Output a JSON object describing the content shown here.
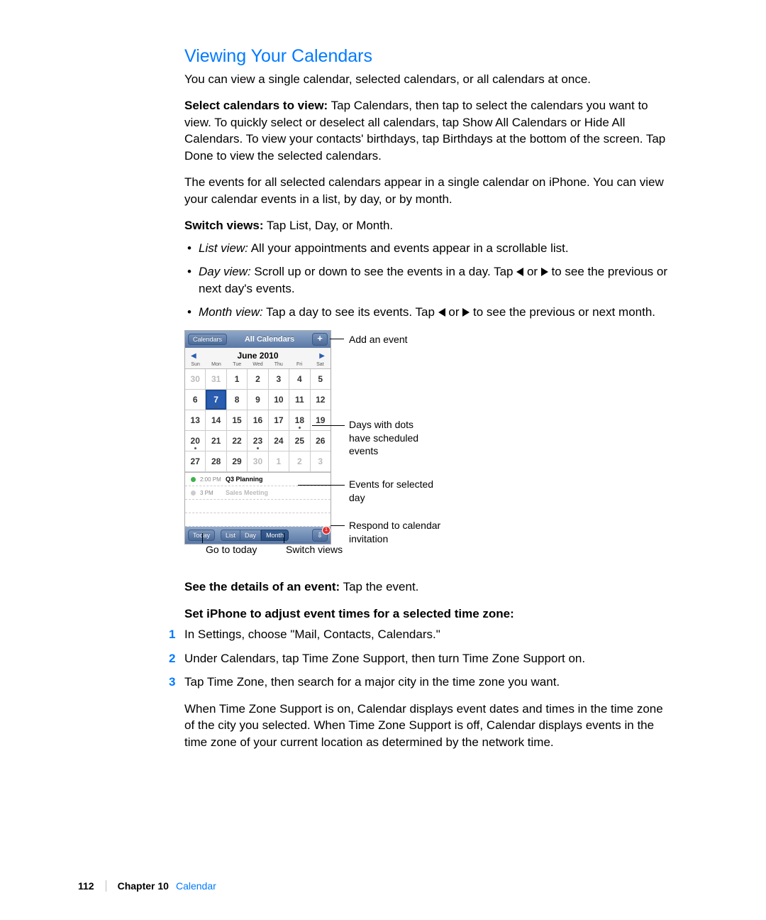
{
  "heading": "Viewing Your Calendars",
  "p1": "You can view a single calendar, selected calendars, or all calendars at once.",
  "p2_lead": "Select calendars to view:",
  "p2_rest": "  Tap Calendars, then tap to select the calendars you want to view. To quickly select or deselect all calendars, tap Show All Calendars or Hide All Calendars. To view your contacts' birthdays, tap Birthdays at the bottom of the screen. Tap Done to view the selected calendars.",
  "p3": "The events for all selected calendars appear in a single calendar on iPhone. You can view your calendar events in a list, by day, or by month.",
  "p4_lead": "Switch views:",
  "p4_rest": "  Tap List, Day, or Month.",
  "bullets": {
    "b1_label": "List view:",
    "b1_rest": " All your appointments and events appear in a scrollable list.",
    "b2_label": "Day view:",
    "b2_a": " Scroll up or down to see the events in a day. Tap ",
    "b2_b": " or ",
    "b2_c": " to see the previous or next day's events.",
    "b3_label": "Month view:",
    "b3_a": " Tap a day to see its events. Tap ",
    "b3_b": " or ",
    "b3_c": " to see the previous or next month."
  },
  "figure": {
    "nav": {
      "calendars_btn": "Calendars",
      "title": "All Calendars"
    },
    "month_title": "June 2010",
    "dow": [
      "Sun",
      "Mon",
      "Tue",
      "Wed",
      "Thu",
      "Fri",
      "Sat"
    ],
    "grid": [
      [
        {
          "n": "30",
          "g": 1
        },
        {
          "n": "31",
          "g": 1
        },
        {
          "n": "1"
        },
        {
          "n": "2"
        },
        {
          "n": "3"
        },
        {
          "n": "4"
        },
        {
          "n": "5"
        }
      ],
      [
        {
          "n": "6"
        },
        {
          "n": "7",
          "sel": 1,
          "d": 1
        },
        {
          "n": "8"
        },
        {
          "n": "9"
        },
        {
          "n": "10"
        },
        {
          "n": "11"
        },
        {
          "n": "12"
        }
      ],
      [
        {
          "n": "13"
        },
        {
          "n": "14"
        },
        {
          "n": "15"
        },
        {
          "n": "16"
        },
        {
          "n": "17"
        },
        {
          "n": "18",
          "d": 1
        },
        {
          "n": "19"
        }
      ],
      [
        {
          "n": "20",
          "d": 1
        },
        {
          "n": "21"
        },
        {
          "n": "22"
        },
        {
          "n": "23",
          "d": 1
        },
        {
          "n": "24"
        },
        {
          "n": "25"
        },
        {
          "n": "26"
        }
      ],
      [
        {
          "n": "27"
        },
        {
          "n": "28"
        },
        {
          "n": "29"
        },
        {
          "n": "30",
          "g": 1
        },
        {
          "n": "1",
          "g": 1
        },
        {
          "n": "2",
          "g": 1
        },
        {
          "n": "3",
          "g": 1
        }
      ]
    ],
    "events": [
      {
        "color": "green",
        "time": "2:00 PM",
        "title": "Q3 Planning"
      },
      {
        "color": "grey",
        "time": "3 PM",
        "title": "Sales Meeting"
      }
    ],
    "toolbar": {
      "today": "Today",
      "list": "List",
      "day": "Day",
      "month": "Month"
    },
    "callouts": {
      "add": "Add an event",
      "dots": "Days with dots have scheduled events",
      "events": "Events for selected day",
      "inbox": "Respond to calendar invitation",
      "today": "Go to today",
      "switch": "Switch views"
    }
  },
  "p5_lead": "See the details of an event:",
  "p5_rest": "  Tap the event.",
  "p6_lead": "Set iPhone to adjust event times for a selected time zone:",
  "steps": {
    "s1": "In Settings, choose \"Mail, Contacts, Calendars.\"",
    "s2": "Under Calendars, tap Time Zone Support, then turn Time Zone Support on.",
    "s3": "Tap Time Zone, then search for a major city in the time zone you want."
  },
  "p7": "When Time Zone Support is on, Calendar displays event dates and times in the time zone of the city you selected. When Time Zone Support is off, Calendar displays events in the time zone of your current location as determined by the network time.",
  "footer": {
    "page": "112",
    "chapter": "Chapter 10",
    "title": "Calendar"
  }
}
